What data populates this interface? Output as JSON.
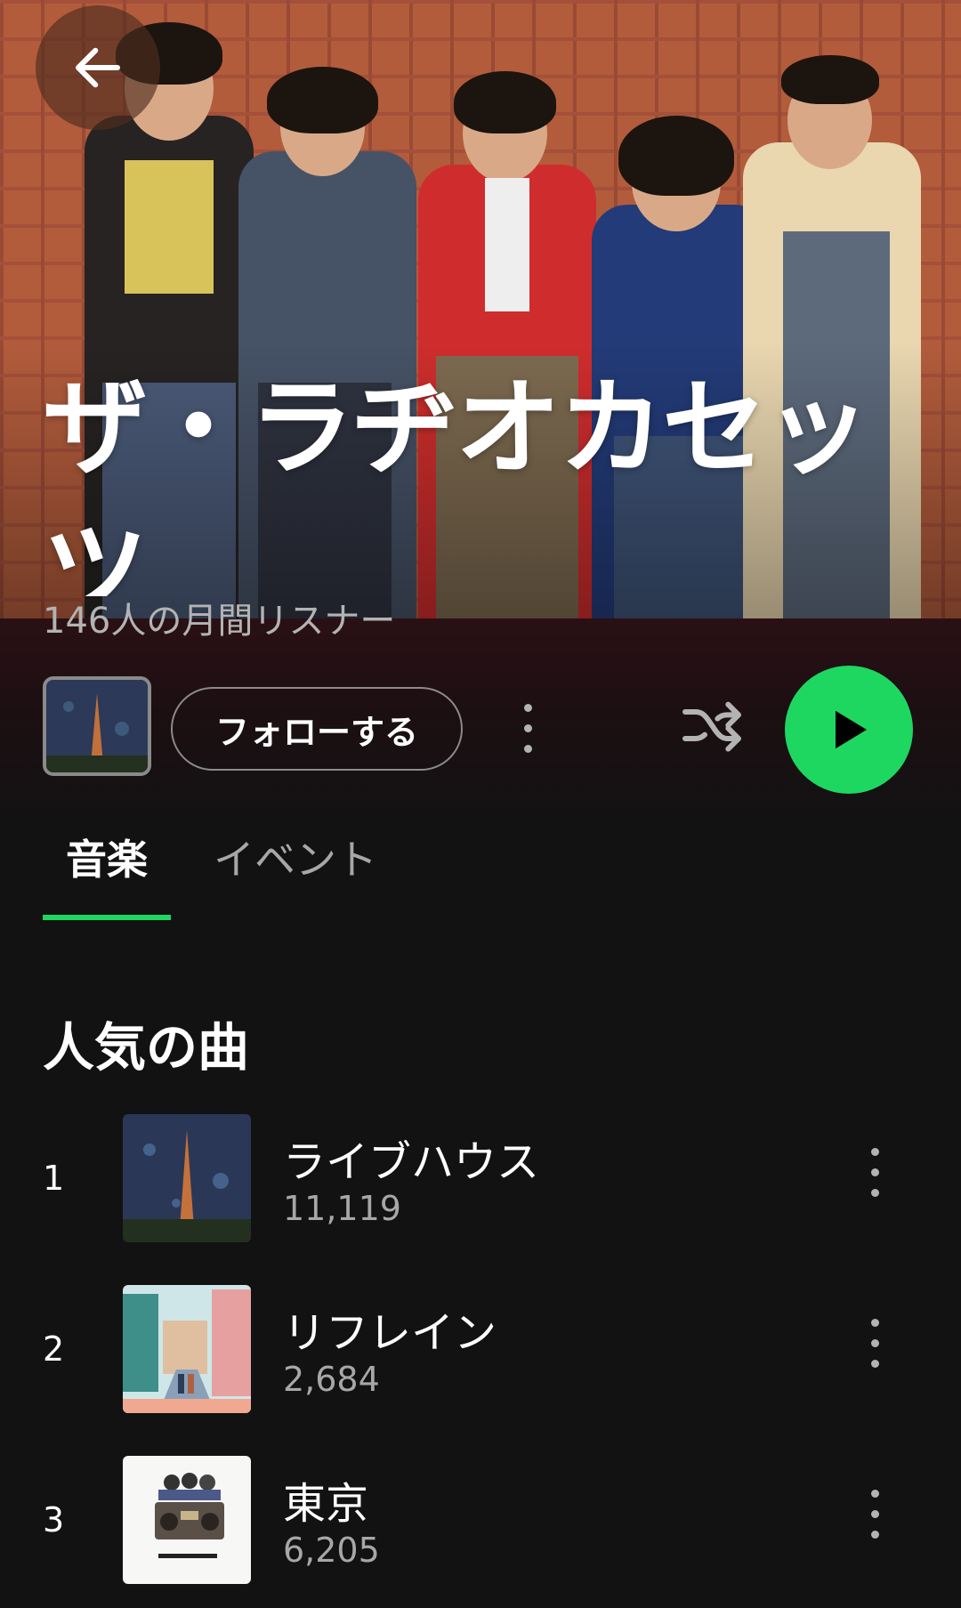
{
  "artist": {
    "name": "ザ・ラヂオカセッツ",
    "monthly_listeners": "146人の月間リスナー"
  },
  "actions": {
    "follow_label": "フォローする"
  },
  "tabs": [
    {
      "label": "音楽",
      "active": true
    },
    {
      "label": "イベント",
      "active": false
    }
  ],
  "popular": {
    "title": "人気の曲",
    "tracks": [
      {
        "rank": "1",
        "title": "ライブハウス",
        "plays": "11,119"
      },
      {
        "rank": "2",
        "title": "リフレイン",
        "plays": "2,684"
      },
      {
        "rank": "3",
        "title": "東京",
        "plays": "6,205"
      }
    ]
  },
  "colors": {
    "accent": "#1ed760",
    "background": "#121212"
  },
  "icons": {
    "back": "arrow-left-icon",
    "more": "more-vertical-icon",
    "shuffle": "shuffle-icon",
    "play": "play-icon"
  }
}
